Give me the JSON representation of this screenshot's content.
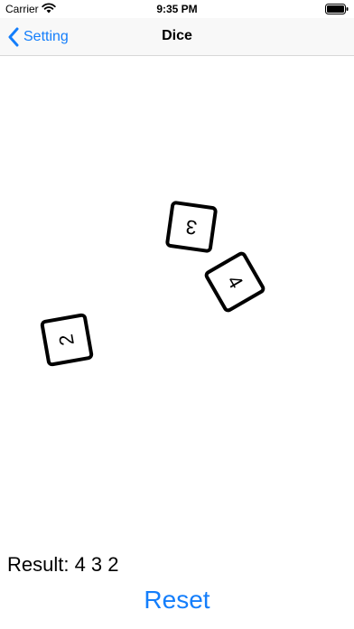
{
  "status_bar": {
    "carrier": "Carrier",
    "time": "9:35 PM"
  },
  "nav": {
    "back_label": "Setting",
    "title": "Dice"
  },
  "dice": [
    {
      "face": "3"
    },
    {
      "face": "4"
    },
    {
      "face": "2"
    }
  ],
  "result": {
    "text": "Result: 4 3 2"
  },
  "reset": {
    "label": "Reset"
  },
  "colors": {
    "accent": "#147efb",
    "nav_background": "#f8f8f8"
  },
  "icons": [
    "wifi-icon",
    "battery-icon",
    "chevron-left-icon"
  ]
}
